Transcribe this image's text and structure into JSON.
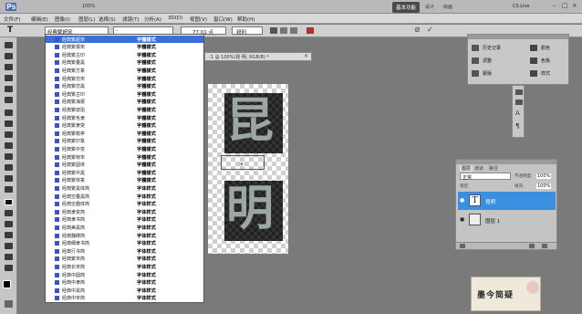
{
  "app": {
    "logo": "Ps",
    "zoom": "100%",
    "workspace": "基本功能",
    "workspace_design": "设计",
    "workspace_draw": "绘画",
    "cslive": "CS Live"
  },
  "menu": [
    "文件(F)",
    "编辑(E)",
    "图像(I)",
    "图层(L)",
    "选择(S)",
    "滤镜(T)",
    "分析(A)",
    "3D(D)",
    "视图(V)",
    "窗口(W)",
    "帮助(H)"
  ],
  "options": {
    "tool": "T",
    "font_family": "经典繁超宋",
    "font_style": "-",
    "font_size": "77.01 点",
    "anti_alias": "锐利"
  },
  "document": {
    "tab": "-1 @ 100%(昆 明, RGB/8) *",
    "glyph1": "昆",
    "glyph2": "明"
  },
  "font_list": [
    {
      "name": "经典繁超宋",
      "preview": "字體樣式"
    },
    {
      "name": "经典繁报宋",
      "preview": "字體樣式"
    },
    {
      "name": "经典繁古印",
      "preview": "字體樣式"
    },
    {
      "name": "经典繁叠黑",
      "preview": "字體樣式"
    },
    {
      "name": "经典繁方篆",
      "preview": "字體樣式"
    },
    {
      "name": "经典繁仿宋",
      "preview": "字體樣式"
    },
    {
      "name": "经典繁仿黑",
      "preview": "字體樣式"
    },
    {
      "name": "经典繁古印",
      "preview": "字體樣式"
    },
    {
      "name": "经典繁海报",
      "preview": "字體樣式"
    },
    {
      "name": "经典繁琥珀",
      "preview": "字體樣式"
    },
    {
      "name": "经典繁毛隶",
      "preview": "字體樣式"
    },
    {
      "name": "经典繁隶变",
      "preview": "字體樣式"
    },
    {
      "name": "经典繁勘亭",
      "preview": "字體樣式"
    },
    {
      "name": "经典繁印篆",
      "preview": "字體樣式"
    },
    {
      "name": "经典繁中变",
      "preview": "字體樣式"
    },
    {
      "name": "经典繁特宋",
      "preview": "字體樣式"
    },
    {
      "name": "经典繁圆体",
      "preview": "字體樣式"
    },
    {
      "name": "经典繁中黑",
      "preview": "字體樣式"
    },
    {
      "name": "经典繁体篆",
      "preview": "字體樣式"
    },
    {
      "name": "经典繁黑体简",
      "preview": "字体样式"
    },
    {
      "name": "经典空叠黑简",
      "preview": "字体样式"
    },
    {
      "name": "经典空趣体简",
      "preview": "字体样式"
    },
    {
      "name": "经典隶变简",
      "preview": "字体样式"
    },
    {
      "name": "经典隶书简",
      "preview": "字体样式"
    },
    {
      "name": "经典美黑简",
      "preview": "字体样式"
    },
    {
      "name": "经典魏碑简",
      "preview": "字体样式"
    },
    {
      "name": "经典细隶书简",
      "preview": "字体样式"
    },
    {
      "name": "经典行书简",
      "preview": "字体样式"
    },
    {
      "name": "经典繁宋简",
      "preview": "字体样式"
    },
    {
      "name": "经典长宋简",
      "preview": "字体样式"
    },
    {
      "name": "经典中圆简",
      "preview": "字体样式"
    },
    {
      "name": "经典中隶简",
      "preview": "字体样式"
    },
    {
      "name": "经典中黑简",
      "preview": "字体样式"
    },
    {
      "name": "经典中宋简",
      "preview": "字体样式"
    }
  ],
  "panel": {
    "history": "历史记录",
    "adjust": "调整",
    "mask": "蒙版",
    "color": "颜色",
    "swatch": "色板",
    "style": "样式"
  },
  "layers": {
    "tab_layers": "图层",
    "tab_channels": "通道",
    "tab_paths": "路径",
    "blend": "正常",
    "opacity_label": "不透明度:",
    "opacity": "100%",
    "lock": "锁定:",
    "fill_label": "填充:",
    "fill": "100%",
    "items": [
      {
        "name": "昆明",
        "type": "T"
      },
      {
        "name": "图层 1",
        "type": "img"
      }
    ]
  },
  "ad": {
    "text": "墨今简疑"
  }
}
